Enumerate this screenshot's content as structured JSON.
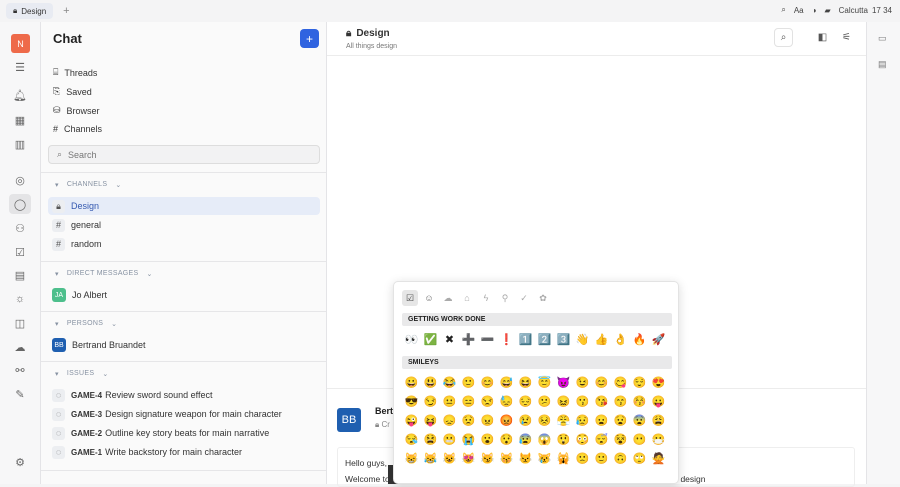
{
  "topbar": {
    "tab": "Design",
    "font_label": "Aa",
    "location": "Calcutta",
    "time": "17 34"
  },
  "rail": {
    "avatar": "N"
  },
  "sidebar": {
    "title": "Chat",
    "nav": [
      {
        "label": "Threads",
        "icon": "threads-icon"
      },
      {
        "label": "Saved",
        "icon": "bookmark-icon"
      },
      {
        "label": "Browser",
        "icon": "browser-icon"
      },
      {
        "label": "Channels",
        "icon": "channels-icon"
      }
    ],
    "search_placeholder": "Search",
    "channels_header": "CHANNELS",
    "channels": [
      "Design",
      "general",
      "random"
    ],
    "dm_header": "DIRECT MESSAGES",
    "dms": [
      {
        "initials": "JA",
        "name": "Jo Albert",
        "color": "#4dbf8c"
      }
    ],
    "persons_header": "PERSONS",
    "persons": [
      {
        "initials": "BB",
        "name": "Bertrand Bruandet",
        "color": "#1f5fb0"
      }
    ],
    "issues_header": "ISSUES",
    "issues": [
      {
        "id": "GAME-4",
        "title": "Review sword sound effect"
      },
      {
        "id": "GAME-3",
        "title": "Design signature weapon for main character"
      },
      {
        "id": "GAME-2",
        "title": "Outline key story beats for main narrative"
      },
      {
        "id": "GAME-1",
        "title": "Write backstory for main character"
      }
    ]
  },
  "main": {
    "title": "Design",
    "subtitle": "All things design",
    "author": "Bertr",
    "author_initials": "BB",
    "created": "Cr",
    "message_line1": "Hello guys,",
    "message_line2_start": "Welcome to",
    "message_line2_end": "to design"
  },
  "picker": {
    "cat1": "GETTING WORK DONE",
    "cat2": "SMILEYS",
    "work": [
      "👀",
      "✅",
      "✖",
      "➕",
      "➖",
      "❗",
      "1️⃣",
      "2️⃣",
      "3️⃣",
      "👋",
      "👍",
      "👌",
      "🔥",
      "🚀"
    ],
    "smileys": [
      "😀",
      "😃",
      "😂",
      "🙂",
      "😊",
      "😅",
      "😆",
      "😇",
      "😈",
      "😉",
      "😊",
      "😋",
      "😌",
      "😍",
      "😎",
      "😏",
      "😐",
      "😑",
      "😒",
      "😓",
      "😔",
      "😕",
      "😖",
      "😗",
      "😘",
      "😙",
      "😚",
      "😛",
      "😜",
      "😝",
      "😞",
      "😟",
      "😠",
      "😡",
      "😢",
      "😣",
      "😤",
      "😥",
      "😦",
      "😧",
      "😨",
      "😩",
      "😪",
      "😫",
      "😬",
      "😭",
      "😮",
      "😯",
      "😰",
      "😱",
      "😲",
      "😳",
      "😴",
      "😵",
      "😶",
      "😷",
      "😸",
      "😹",
      "😺",
      "😻",
      "😼",
      "😽",
      "😾",
      "😿",
      "🙀",
      "🙁",
      "🙂",
      "🙃",
      "🙄",
      "🙅"
    ]
  }
}
